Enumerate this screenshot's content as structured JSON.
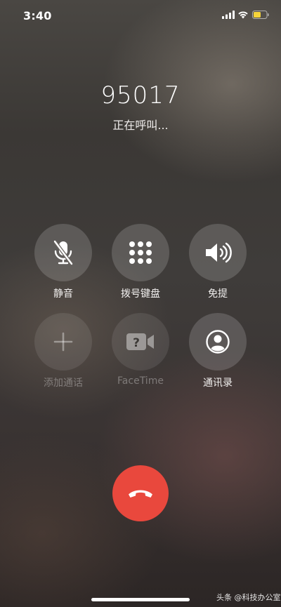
{
  "status_bar": {
    "time": "3:40",
    "signal_icon": "cellular-signal-icon",
    "wifi_icon": "wifi-icon",
    "battery_icon": "battery-icon",
    "battery_color": "#f5d33a"
  },
  "call": {
    "number": "95017",
    "status": "正在呼叫..."
  },
  "controls": [
    {
      "label": "静音",
      "icon": "mute-microphone-icon",
      "enabled": true
    },
    {
      "label": "拨号键盘",
      "icon": "keypad-icon",
      "enabled": true
    },
    {
      "label": "免提",
      "icon": "speaker-icon",
      "enabled": true
    },
    {
      "label": "添加通话",
      "icon": "plus-icon",
      "enabled": false
    },
    {
      "label": "FaceTime",
      "icon": "facetime-video-icon",
      "enabled": false
    },
    {
      "label": "通讯录",
      "icon": "contacts-icon",
      "enabled": true
    }
  ],
  "end_call": {
    "icon": "end-call-icon",
    "color": "#e9483d"
  },
  "watermark": {
    "text": "头条 @科技办公室"
  }
}
